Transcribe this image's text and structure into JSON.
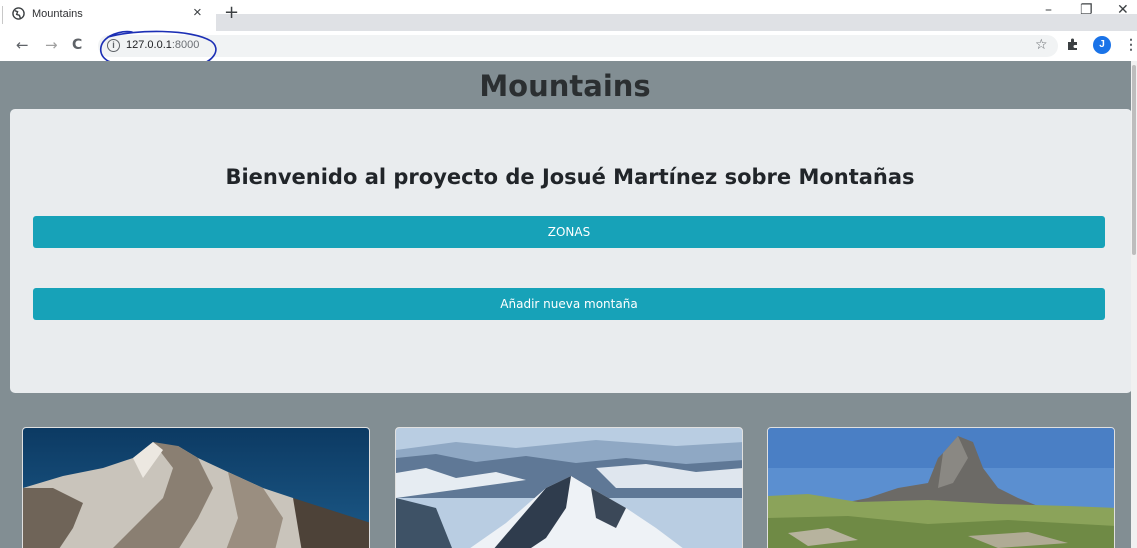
{
  "browser": {
    "tab_title": "Mountains",
    "tab_close": "×",
    "new_tab": "+",
    "url_host": "127.0.0.1",
    "url_port": ":8000",
    "profile_initial": "J",
    "window_controls": {
      "minimize": "–",
      "restore": "❐",
      "close": "✕"
    },
    "icons": [
      "back-arrow-icon",
      "forward-arrow-icon",
      "reload-icon",
      "info-icon",
      "star-icon",
      "extensions-icon",
      "menu-icon"
    ]
  },
  "page": {
    "title": "Mountains",
    "welcome": "Bienvenido al proyecto de Josué Martínez sobre Montañas",
    "buttons": {
      "zonas": "ZONAS",
      "add": "Añadir nueva montaña"
    },
    "cards": [
      {
        "image": "mountain-photo-snowy-peak"
      },
      {
        "image": "mountain-photo-snowy-range"
      },
      {
        "image": "mountain-photo-rocky-peak"
      }
    ]
  },
  "colors": {
    "page_background": "#828e93",
    "jumbotron": "#e9ecee",
    "button": "#17a2b8",
    "annotation_ink": "#1c2fb5",
    "avatar": "#1a73e8"
  }
}
